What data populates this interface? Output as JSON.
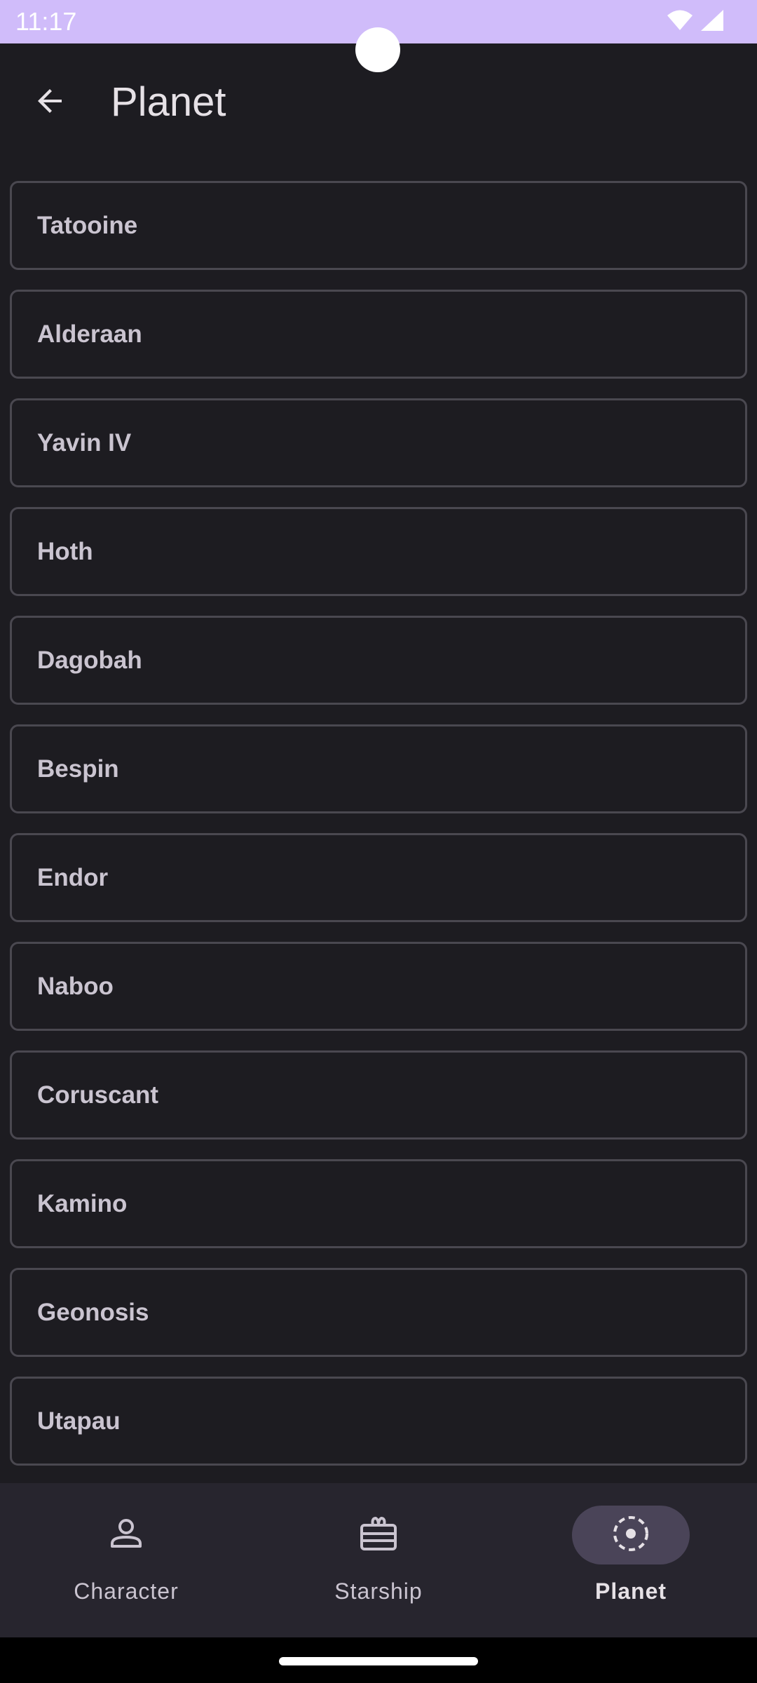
{
  "status_bar": {
    "time": "11:17",
    "icons": [
      "wifi-icon",
      "signal-icon"
    ],
    "color": "#d0bcfa"
  },
  "app_bar": {
    "title": "Planet",
    "back_icon": "arrow-back-icon"
  },
  "planets": [
    "Tatooine",
    "Alderaan",
    "Yavin IV",
    "Hoth",
    "Dagobah",
    "Bespin",
    "Endor",
    "Naboo",
    "Coruscant",
    "Kamino",
    "Geonosis",
    "Utapau"
  ],
  "bottom_nav": {
    "items": [
      {
        "label": "Character",
        "icon": "person-icon",
        "selected": false
      },
      {
        "label": "Starship",
        "icon": "starship-icon",
        "selected": false
      },
      {
        "label": "Planet",
        "icon": "planet-icon",
        "selected": true
      }
    ],
    "active_indicator_color": "#4a4458"
  },
  "colors": {
    "background": "#1d1c21",
    "nav_background": "#27252e",
    "item_border": "#4a4850",
    "item_text": "#cac4d0"
  }
}
